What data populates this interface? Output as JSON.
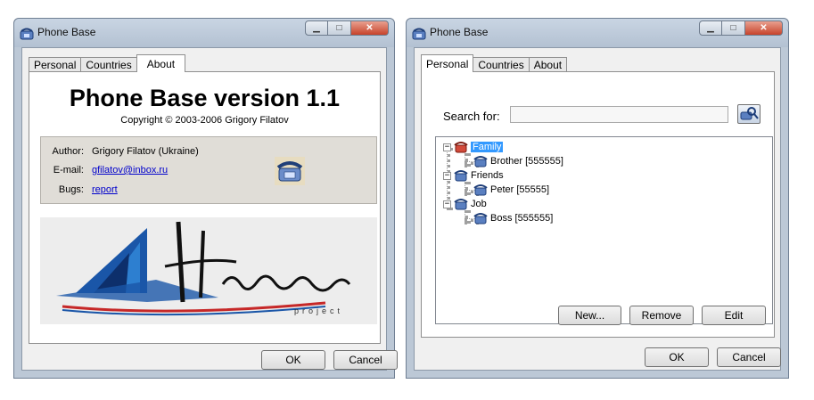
{
  "about_window": {
    "title": "Phone Base",
    "tabs": [
      {
        "label": "Personal",
        "active": false
      },
      {
        "label": "Countries",
        "active": false
      },
      {
        "label": "About",
        "active": true
      }
    ],
    "heading": "Phone Base version 1.1",
    "copyright": "Copyright © 2003-2006 Grigory Filatov",
    "info": {
      "author_label": "Author:",
      "author_value": "Grigory Filatov (Ukraine)",
      "email_label": "E-mail:",
      "email_value": "gfilatov@inbox.ru",
      "bugs_label": "Bugs:",
      "bugs_value": "report"
    },
    "banner_text": "project",
    "ok_label": "OK",
    "cancel_label": "Cancel"
  },
  "personal_window": {
    "title": "Phone Base",
    "tabs": [
      {
        "label": "Personal",
        "active": true
      },
      {
        "label": "Countries",
        "active": false
      },
      {
        "label": "About",
        "active": false
      }
    ],
    "search_label": "Search for:",
    "search_value": "",
    "tree": [
      {
        "label": "Family",
        "selected": true,
        "children": [
          {
            "label": "Brother [555555]"
          }
        ]
      },
      {
        "label": "Friends",
        "selected": false,
        "children": [
          {
            "label": "Peter [55555]"
          }
        ]
      },
      {
        "label": "Job",
        "selected": false,
        "children": [
          {
            "label": "Boss [555555]"
          }
        ]
      }
    ],
    "new_label": "New...",
    "remove_label": "Remove",
    "edit_label": "Edit",
    "ok_label": "OK",
    "cancel_label": "Cancel"
  },
  "colors": {
    "selection": "#3399ff",
    "close_button": "#c7432b",
    "link": "#0000cc"
  }
}
